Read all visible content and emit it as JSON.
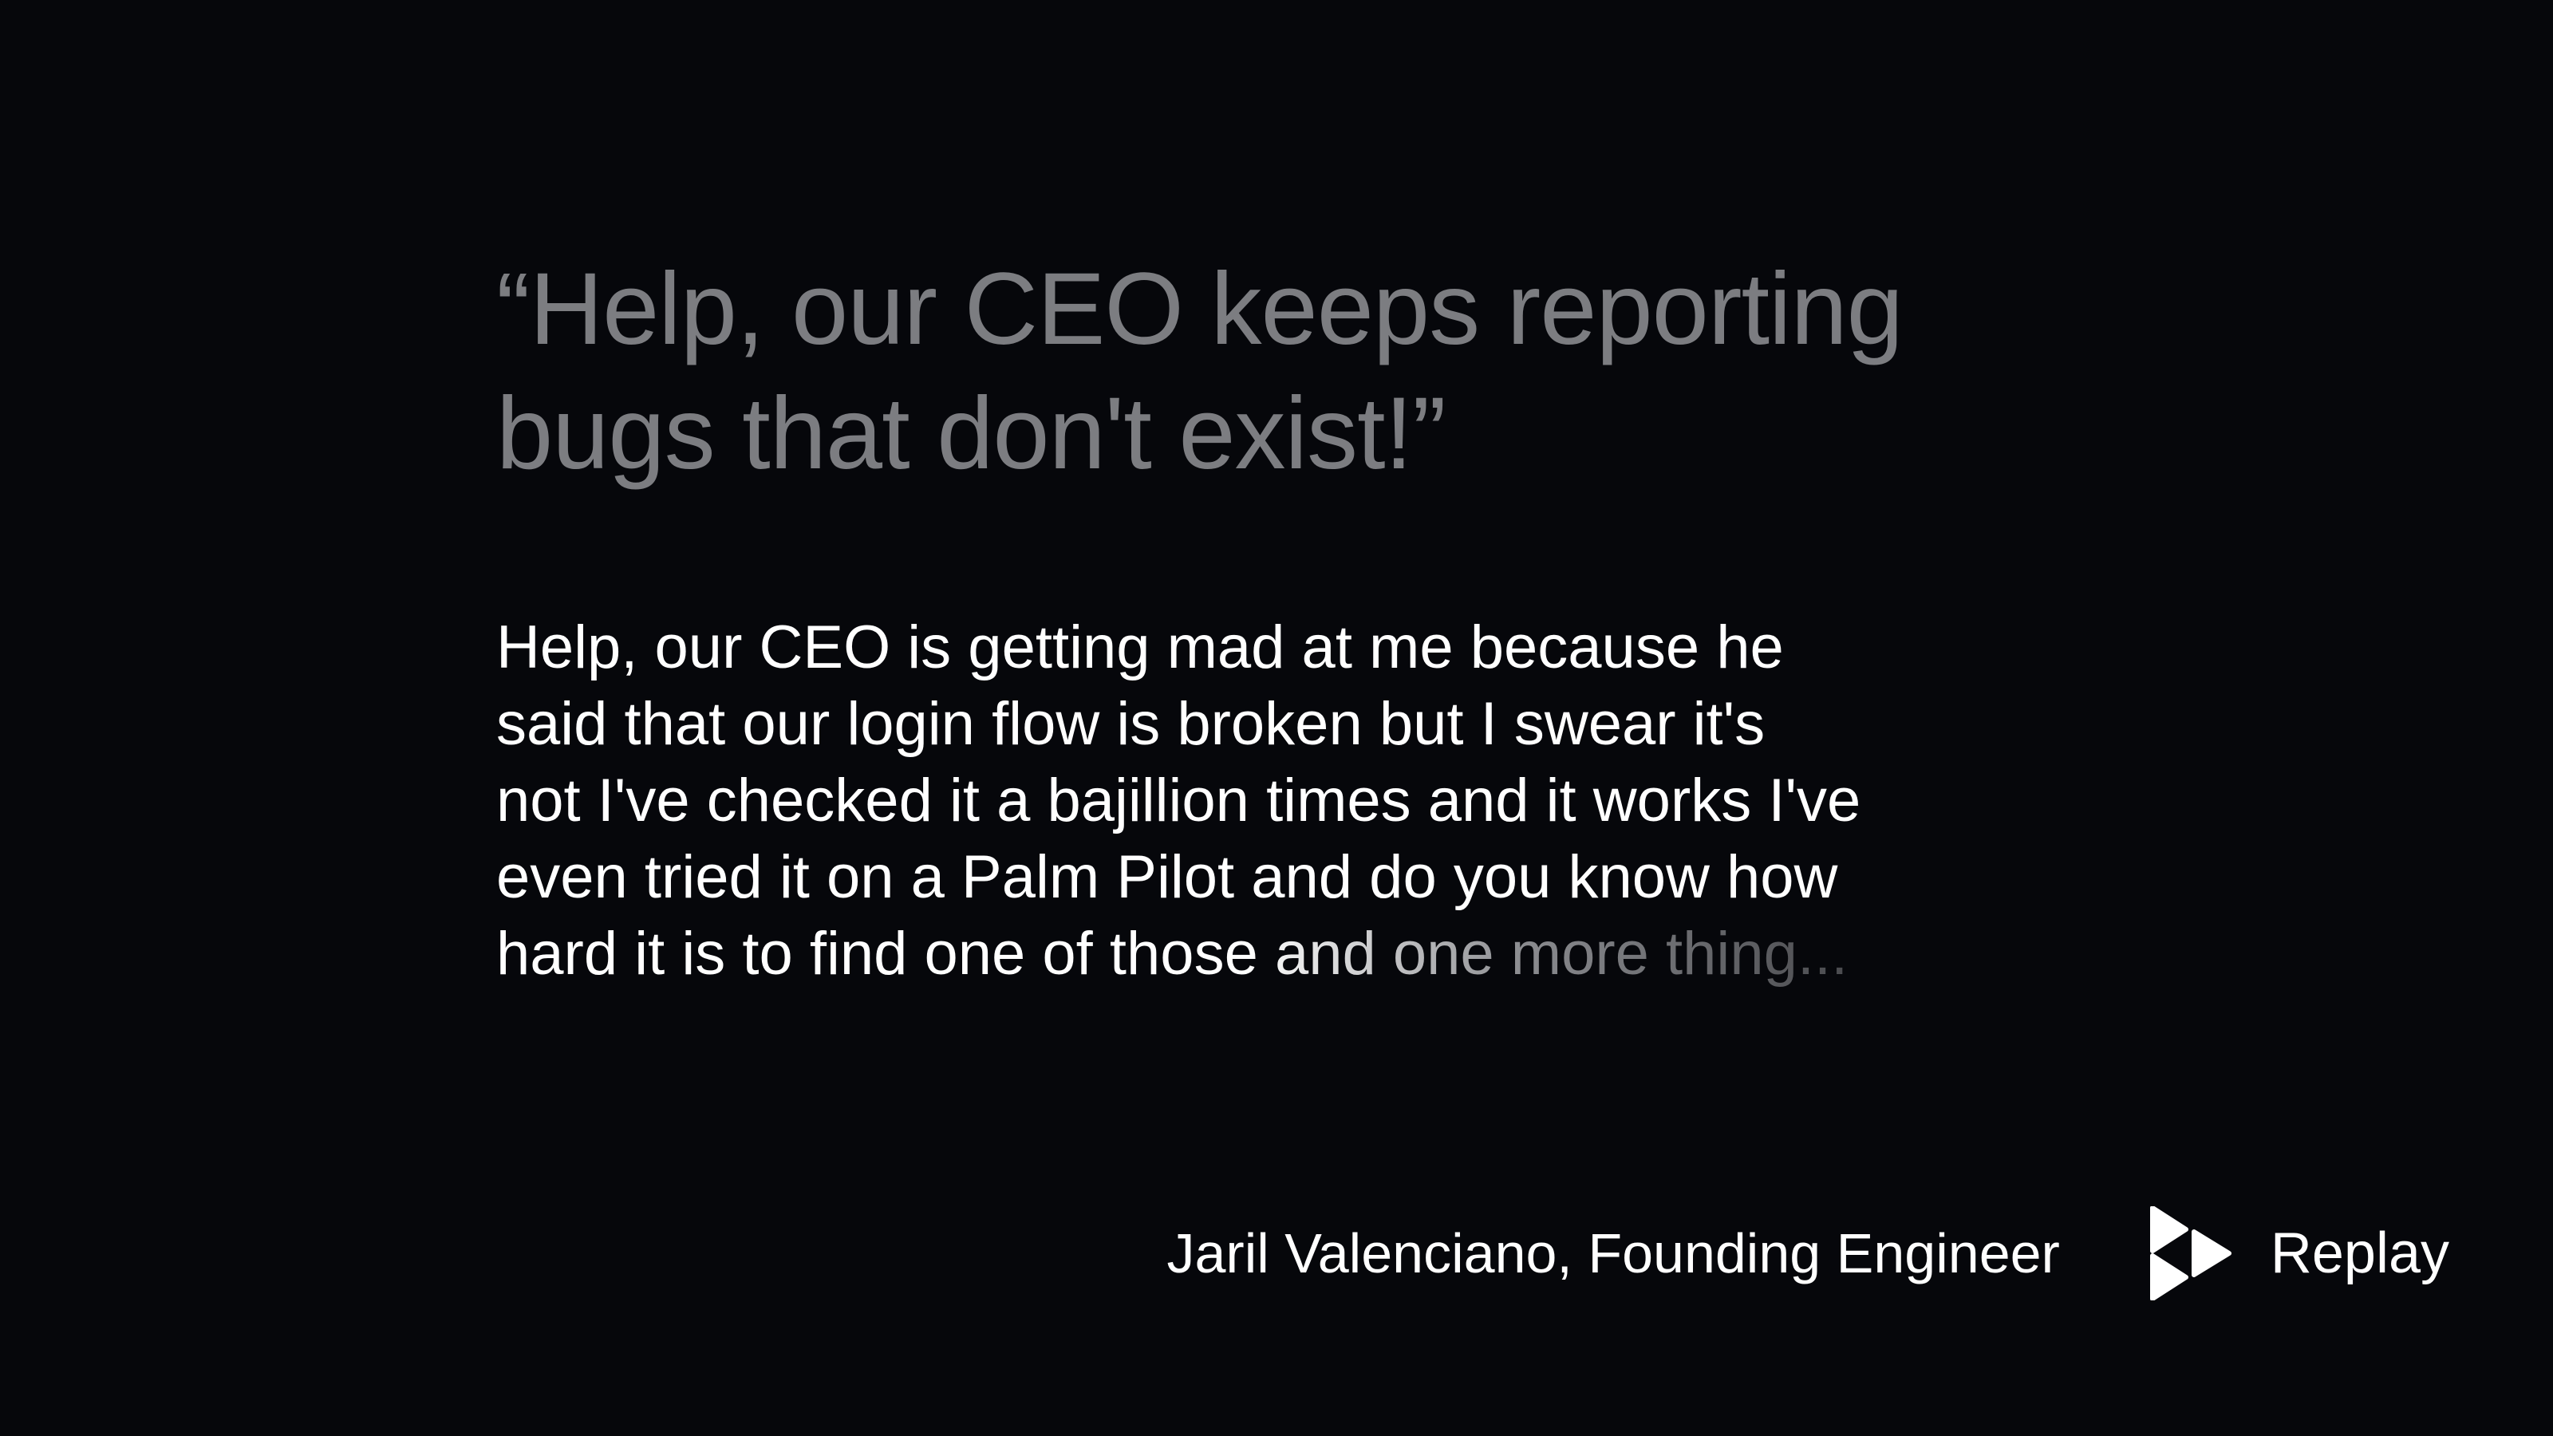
{
  "quote": {
    "headline_line1": "“Help, our CEO keeps reporting",
    "headline_line2": "bugs that don't exist!”",
    "body_lines": [
      "Help, our CEO is getting mad at me because he",
      "said that our login flow is broken but I swear it's",
      "not I've checked it a bajillion times and it works I've",
      "even tried it on a Palm Pilot and do you know how"
    ],
    "body_last_start": "hard it is to find ",
    "body_last_fade": "one of those and one more thing..."
  },
  "attribution": {
    "text": "Jaril Valenciano, Founding Engineer"
  },
  "brand": {
    "logo_icon": "replay-logo-icon",
    "name": "Replay"
  },
  "colors": {
    "background": "#06070b",
    "headline": "#7c7d81",
    "body": "#ffffff"
  }
}
